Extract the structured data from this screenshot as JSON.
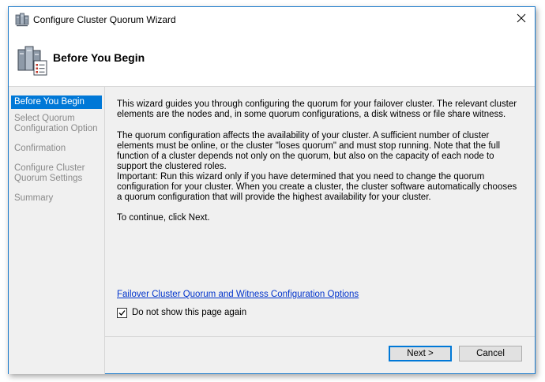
{
  "window": {
    "title": "Configure Cluster Quorum Wizard",
    "title_icon": "cluster-servers-icon",
    "close_icon": "close-icon"
  },
  "header": {
    "title": "Before You Begin",
    "icon": "cluster-checklist-icon"
  },
  "sidebar": {
    "items": [
      {
        "label": "Before You Begin",
        "active": true
      },
      {
        "label": "Select Quorum Configuration Option",
        "active": false
      },
      {
        "label": "Confirmation",
        "active": false
      },
      {
        "label": "Configure Cluster Quorum Settings",
        "active": false
      },
      {
        "label": "Summary",
        "active": false
      }
    ]
  },
  "main": {
    "paragraphs": [
      "This wizard guides you through configuring the quorum for your failover cluster. The relevant cluster elements are the nodes and, in some quorum configurations, a disk witness or file share witness.",
      "The quorum configuration affects the availability of your cluster. A sufficient number of cluster elements must be online, or the cluster \"loses quorum\" and must stop running. Note that the full function of a cluster depends not only on the quorum, but also on the capacity of each node to support the clustered roles.",
      "Important: Run this wizard only if you have determined that you need to change the quorum configuration for your cluster. When you create a cluster, the cluster software automatically chooses a quorum configuration that will provide the highest availability for your cluster.",
      "To continue, click Next."
    ],
    "link": "Failover Cluster Quorum and Witness Configuration Options",
    "checkbox": {
      "label": "Do not show this page again",
      "checked": true
    }
  },
  "buttons": {
    "next": "Next >",
    "cancel": "Cancel"
  },
  "colors": {
    "accent": "#0078d7",
    "link": "#0033cc",
    "disabled_text": "#8a8a8a"
  }
}
